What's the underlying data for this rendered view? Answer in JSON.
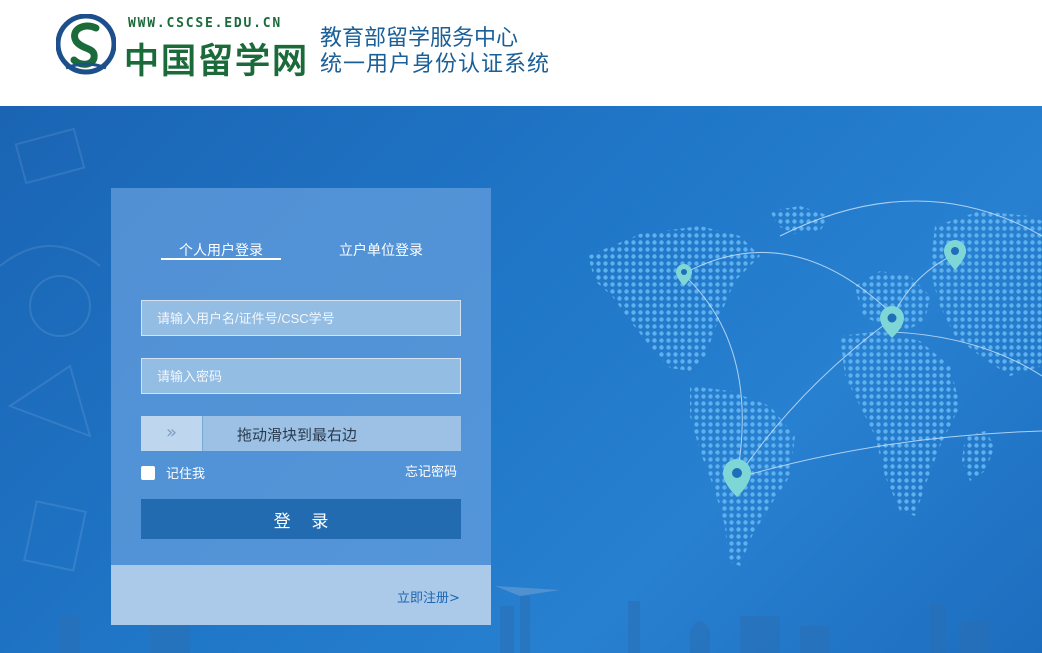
{
  "header": {
    "logo_url_text": "WWW.CSCSE.EDU.CN",
    "logo_cn_text": "中国留学网",
    "system_title_line1": "教育部留学服务中心",
    "system_title_line2": "统一用户身份认证系统"
  },
  "login": {
    "tabs": [
      {
        "label": "个人用户登录",
        "active": true
      },
      {
        "label": "立户单位登录",
        "active": false
      }
    ],
    "username_placeholder": "请输入用户名/证件号/CSC学号",
    "password_placeholder": "请输入密码",
    "slider_handle_symbol": "»",
    "slider_text": "拖动滑块到最右边",
    "remember_label": "记住我",
    "forgot_password": "忘记密码",
    "login_button": "登 录",
    "register_link": "立即注册>"
  },
  "colors": {
    "brand_green": "#1b6a3a",
    "title_blue": "#1a5f97",
    "banner_blue": "#2077c8",
    "button_blue": "#236bb0",
    "pin_teal": "#7fd6d6"
  },
  "icons": [
    "cscse-logo",
    "map-pin-icon",
    "double-chevron-right-icon",
    "checkbox-icon"
  ]
}
